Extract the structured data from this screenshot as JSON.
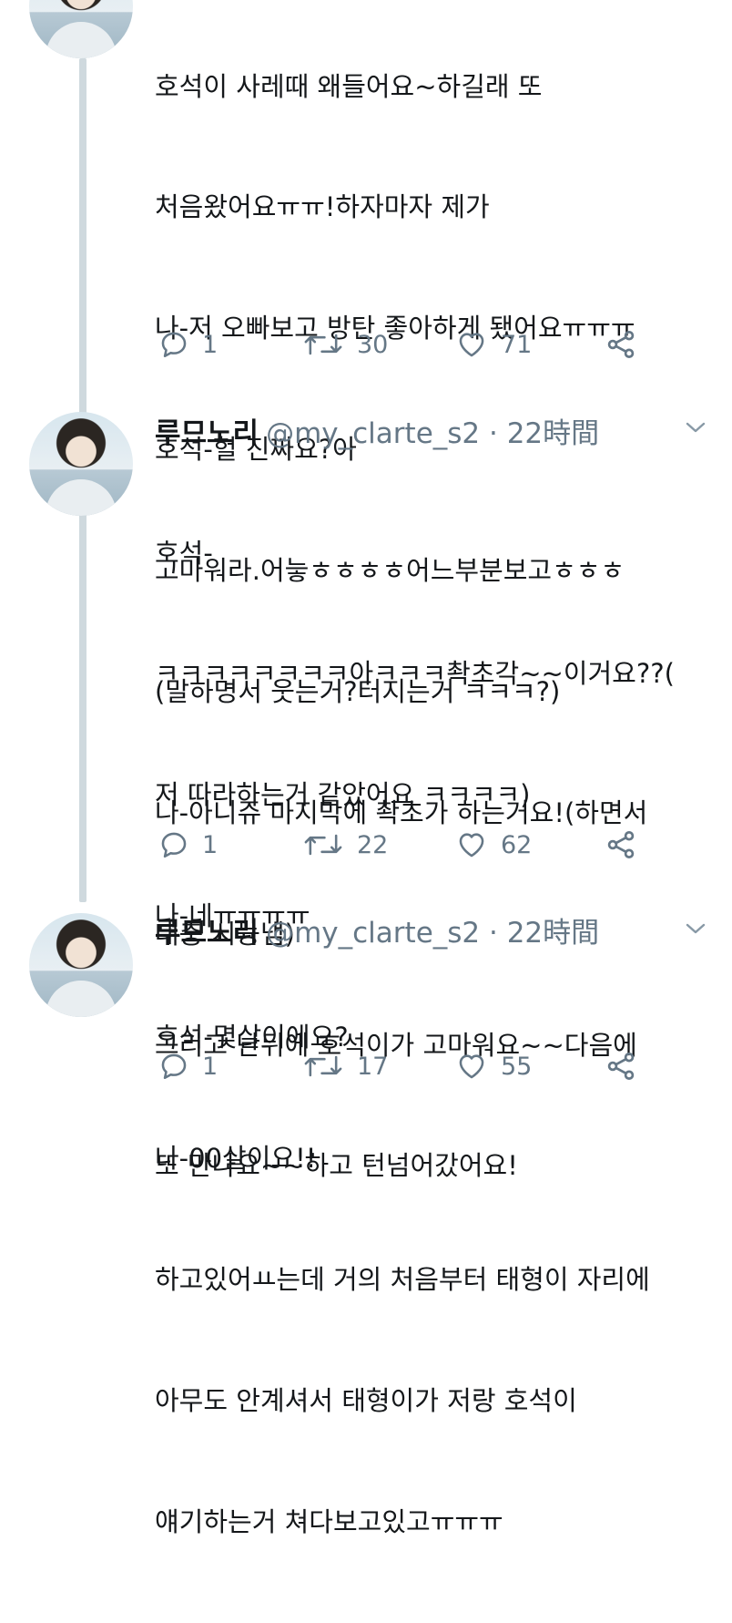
{
  "tweets": [
    {
      "name": "",
      "handle": "",
      "time": "",
      "lines": [
        "호석이 사레때 왜들어요~하길래 또",
        "처음왔어요ㅠㅠ!하자마자 제가",
        "나-저 오빠보고 방탄 좋아하게 됐어요ㅠㅠㅠ",
        "호석-헐 진짜요?아",
        "고마워라.어늫ㅎㅎㅎㅎ어느부분보고ㅎㅎㅎ",
        "(말하명서 웃는거?터지는거 ㅋㅋㅋ?)",
        "나-아니쥬 마지막에 촥초가 하는거요!(하면서",
        "대충 시늉냄)"
      ],
      "replies": "1",
      "retweets": "30",
      "likes": "71"
    },
    {
      "name": "루므노리",
      "handle": "@my_clarte_s2 · 22時間",
      "lines": [
        "호석-",
        "ㅋㅋㅋㅋㅋㅋㅋㅋ아ㅋㅋㅋ촥초각~~이거요??(",
        "저 따라하는거 같았어요 ㅋㅋㅋㅋ)",
        "나-네ㅠㅠㅠㅠ",
        "호석-몇살이에요?",
        "나-00살이요!!",
        "하고있어ㅛ는데 거의 처음부터 태형이 자리에",
        "아무도 안계셔서 태형이가 저랑 호석이",
        "얘기하는거 쳐다보고있고ㅠㅠㅠ"
      ],
      "replies": "1",
      "retweets": "22",
      "likes": "62"
    },
    {
      "name": "루므노리",
      "handle": "@my_clarte_s2 · 22時間",
      "lines": [
        "그리고 난뒤에 호석이가 고마워요~~다음에",
        "또 만나요~~하고 턴넘어갔어요!"
      ],
      "replies": "1",
      "retweets": "17",
      "likes": "55"
    }
  ],
  "icons": {
    "reply": "reply-icon",
    "retweet": "retweet-icon",
    "like": "heart-icon",
    "share": "share-icon",
    "more": "chevron-down-icon"
  },
  "colors": {
    "text": "#14171a",
    "secondary": "#657786",
    "thread_line": "#cfd9de"
  }
}
